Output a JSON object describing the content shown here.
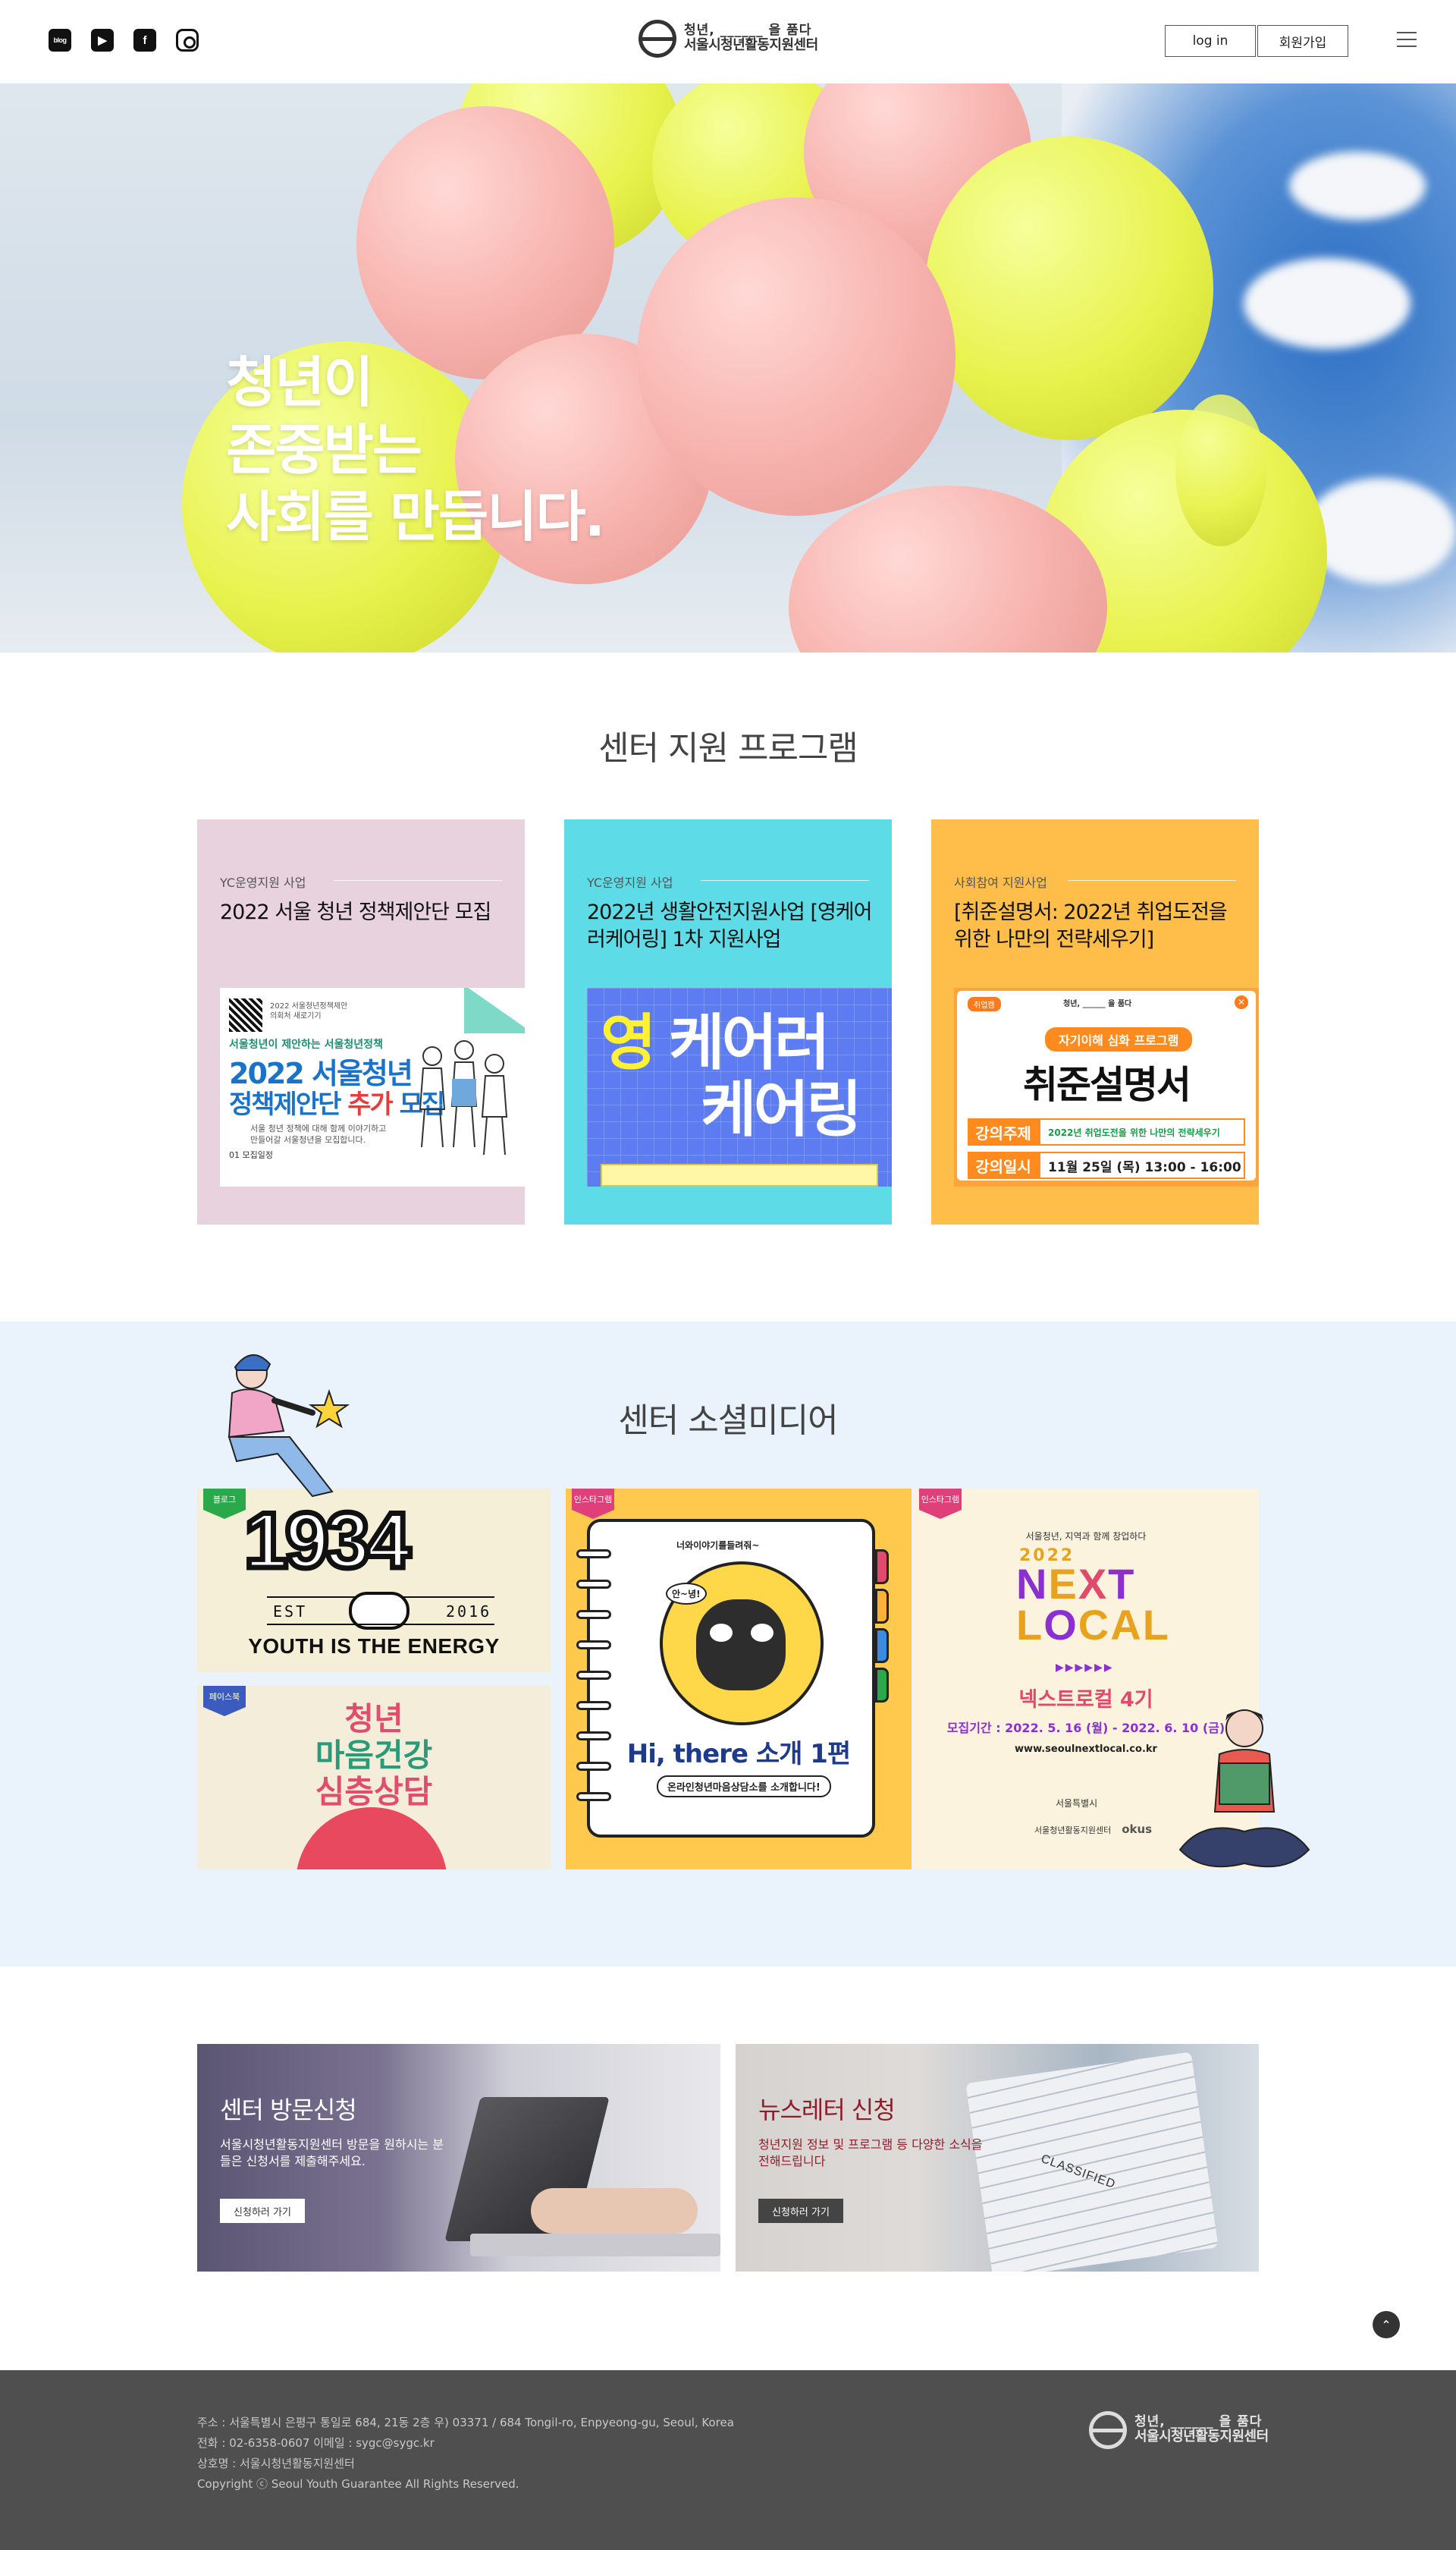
{
  "header": {
    "sns": [
      {
        "name": "blog",
        "glyph": "blog"
      },
      {
        "name": "youtube",
        "glyph": "▶"
      },
      {
        "name": "facebook",
        "glyph": "f"
      },
      {
        "name": "instagram",
        "glyph": ""
      }
    ],
    "logo_line1": "청년, ______ 을 품다",
    "logo_line2": "서울시청년활동지원센터",
    "login": "log in",
    "signup": "회원가입"
  },
  "hero": {
    "lines": [
      "청년이",
      "존중받는",
      "사회를 만듭니다."
    ]
  },
  "programs": {
    "title": "센터 지원 프로그램",
    "cards": [
      {
        "category": "YC운영지원 사업",
        "title": "2022 서울 청년 정책제안단 모집",
        "bg": "#e8d2de",
        "thumb": {
          "small": "2022 서울청년정책제안\n의회처 새로기기",
          "sub": "서울청년이 제안하는 서울청년정책",
          "big1": "2022 서울청년",
          "big2a": "정책제안단",
          "big2b": "추가",
          "big2c": "모집",
          "desc": "서울 청년 정책에 대해 함께 이야기하고\n만들어갈 서울청년을 모집합니다.",
          "list": "01 모집일정"
        }
      },
      {
        "category": "YC운영지원 사업",
        "title": "2022년 생활안전지원사업 [영케어러케어링] 1차 지원사업",
        "bg": "#5ddbe6",
        "thumb": {
          "w1": "영",
          "w2": "케어러",
          "w3": "케어링"
        }
      },
      {
        "category": "사회참여 지원사업",
        "title": "[취준설명서: 2022년 취업도전을 위한 나만의 전략세우기]",
        "bg": "#ffbd4a",
        "thumb": {
          "tag": "취업캠",
          "close": "✕",
          "brand": "청년, ______ 을 품다",
          "pill": "자기이해 심화 프로그램",
          "main": "취준설명서",
          "k1": "강의주제",
          "v1": "2022년 취업도전을 위한 나만의 전략세우기",
          "k2": "강의일시",
          "v2": "11월 25일 (목) 13:00 - 16:00"
        }
      }
    ]
  },
  "social": {
    "title": "센터 소셜미디어",
    "tiles": {
      "t1": {
        "badge": "블로그",
        "badge_color": "#2aa84a",
        "num": "1934",
        "est": "EST",
        "year": "2016",
        "tagline": "YOUTH IS THE ENERGY"
      },
      "t2": {
        "badge": "페이스북",
        "badge_color": "#3b5bbf",
        "l1": "청년",
        "l2": "마음건강",
        "l3": "심층상담"
      },
      "t3": {
        "badge": "인스타그램",
        "badge_color": "#e0407a",
        "top": "너와이야기를들려줘~",
        "bubble": "안~녕!",
        "hi": "Hi, there 소개 1편",
        "sub": "온라인청년마음상담소를 소개합니다!"
      },
      "t4": {
        "badge": "인스타그램",
        "badge_color": "#e0407a",
        "hdr": "서울청년, 지역과 함께 창업하다",
        "yr": "2022",
        "w1": [
          "N",
          "E",
          "X",
          "T"
        ],
        "w2": [
          "L",
          "O",
          "C",
          "A",
          "L"
        ],
        "arrows": "▶▶▶▶▶▶",
        "ttl": "넥스트로컬 4기",
        "period": "모집기간 : 2022. 5. 16 (월) - 2022. 6. 10 (금)",
        "url": "www.seoulnextlocal.co.kr",
        "seoul": "서울특별시",
        "okus_l": "서울청년활동지원센터",
        "okus": "okus"
      }
    }
  },
  "banners": [
    {
      "title": "센터 방문신청",
      "desc": "서울시청년활동지원센터 방문을 원하시는 분들은 신청서를 제출해주세요.",
      "btn": "신청하러 가기"
    },
    {
      "title": "뉴스레터 신청",
      "desc": "청년지원 정보 및 프로그램 등 다양한 소식을 전해드립니다",
      "btn": "신청하러 가기",
      "paper_text": "CLASSIFIED"
    }
  ],
  "to_top": "⌃",
  "footer": {
    "address": "주소 : 서울특별시 은평구 통일로 684, 21동 2층 우) 03371 / 684 Tongil-ro, Enpyeong-gu, Seoul, Korea",
    "contact": "전화 : 02-6358-0607   이메일 : sygc@sygc.kr",
    "name": "상호명 : 서울시청년활동지원센터",
    "copyright": "Copyright ⓒ Seoul Youth Guarantee All Rights Reserved.",
    "logo_line1": "청년, ______ 을 품다",
    "logo_line2": "서울시청년활동지원센터"
  }
}
